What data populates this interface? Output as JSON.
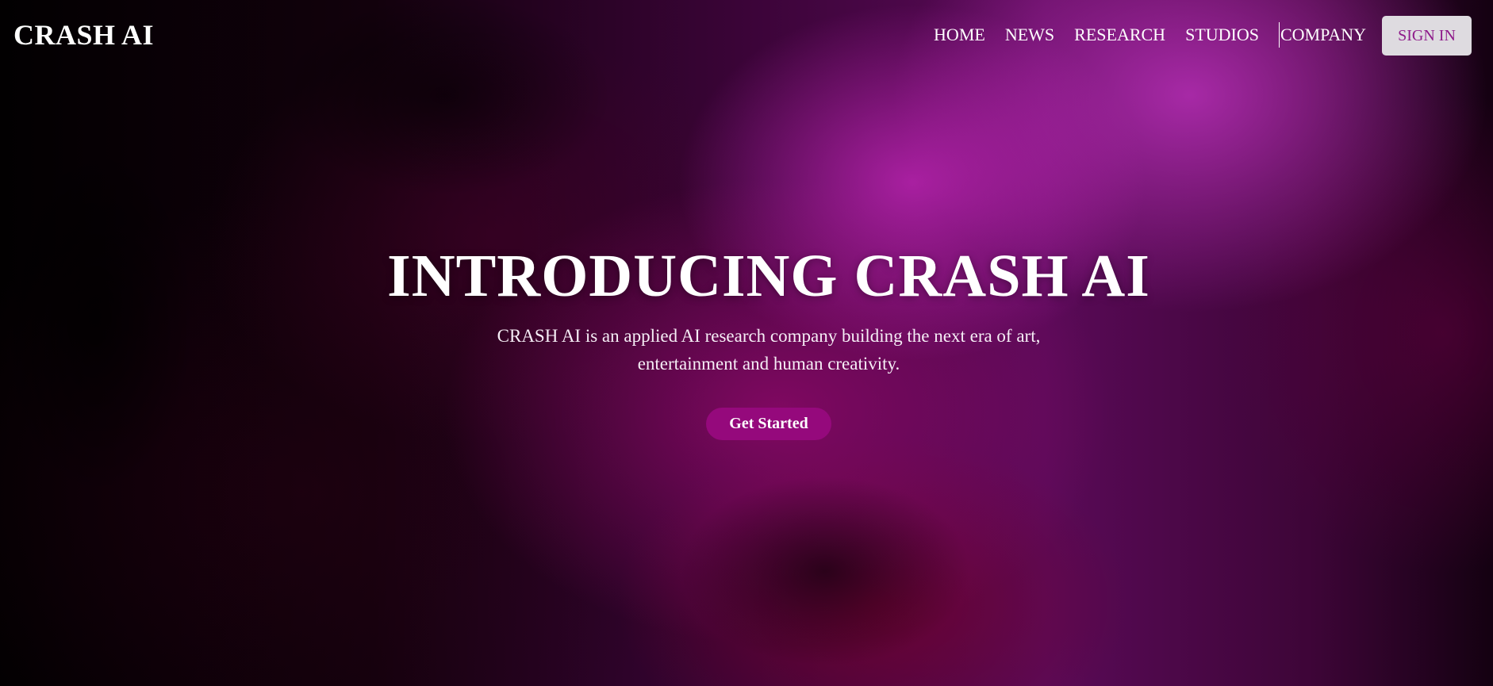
{
  "header": {
    "logo": "CRASH AI",
    "nav": [
      {
        "label": "HOME"
      },
      {
        "label": "NEWS"
      },
      {
        "label": "RESEARCH"
      },
      {
        "label": "STUDIOS"
      },
      {
        "label": "COMPANY"
      }
    ],
    "sign_in_label": "SIGN IN"
  },
  "hero": {
    "title": "INTRODUCING CRASH AI",
    "subtitle": "CRASH AI is an applied AI research company building the next era of art, entertainment and human creativity.",
    "cta_label": "Get Started"
  },
  "colors": {
    "accent": "#95097c",
    "sign_in_bg": "#dedbe0",
    "sign_in_text": "#8e1a8a",
    "text": "#ffffff"
  }
}
